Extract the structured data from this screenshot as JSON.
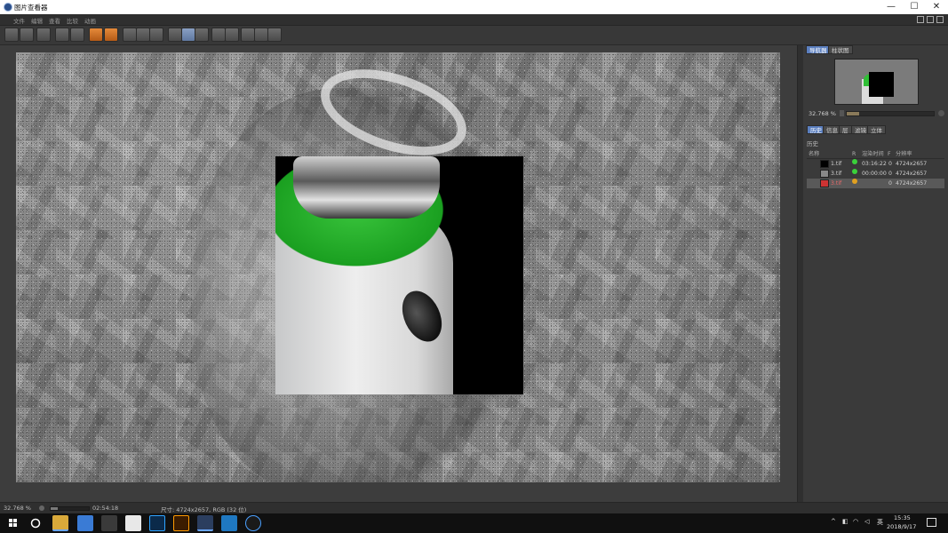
{
  "window": {
    "title": "图片查看器",
    "minimize": "—",
    "maximize": "☐",
    "close": "✕"
  },
  "menu": [
    "文件",
    "编辑",
    "查看",
    "比较",
    "动画"
  ],
  "toolbar": {
    "icons": [
      "open-icon",
      "save-icon",
      "render-icon",
      "compare-icon",
      "zoom-icon",
      "orange-icon-1",
      "orange-icon-2",
      "stack-icon-1",
      "stack-icon-2",
      "search-icon",
      "film-icon",
      "grid-icon-1",
      "grid-icon-2",
      "channel-a-icon",
      "channel-b-icon",
      "rotate-icon",
      "frame-icon",
      "frame-icon-2"
    ]
  },
  "right_panel": {
    "tabs": [
      "导航器",
      "柱状图"
    ],
    "zoom_value": "32.768 %",
    "section_tabs": [
      "历史",
      "信息",
      "层",
      "滤镜",
      "立体"
    ],
    "history_label": "历史",
    "columns": {
      "name": "名称",
      "r": "R",
      "time": "渲染时间",
      "f": "F",
      "resolution": "分辨率"
    },
    "rows": [
      {
        "name": "1.tif",
        "time": "03:16:22",
        "f": "0",
        "resolution": "4724x2657",
        "status_color": "#3ad13a"
      },
      {
        "name": "3.tif",
        "time": "00:00:00",
        "f": "0",
        "resolution": "4724x2657",
        "status_color": "#3ad13a"
      },
      {
        "name": "3.tif",
        "time": "",
        "f": "0",
        "resolution": "4724x2657",
        "status_color": "#e0a020"
      }
    ]
  },
  "status": {
    "zoom": "32.768 %",
    "time": "02:54:18",
    "info": "尺寸: 4724x2657, RGB (32 位)"
  },
  "taskbar": {
    "time": "15:35",
    "date": "2018/9/17",
    "ime": "英",
    "apps": [
      "start-icon",
      "search-circle-icon",
      "file-explorer-icon",
      "store-icon",
      "vs-icon",
      "chrome-icon",
      "photoshop-icon",
      "illustrator-icon",
      "c4d-icon",
      "app-blue-icon",
      "media-icon"
    ]
  },
  "colors": {
    "accent": "#5b7fbf",
    "panel_bg": "#3a3a3a",
    "green": "#3ad13a"
  }
}
